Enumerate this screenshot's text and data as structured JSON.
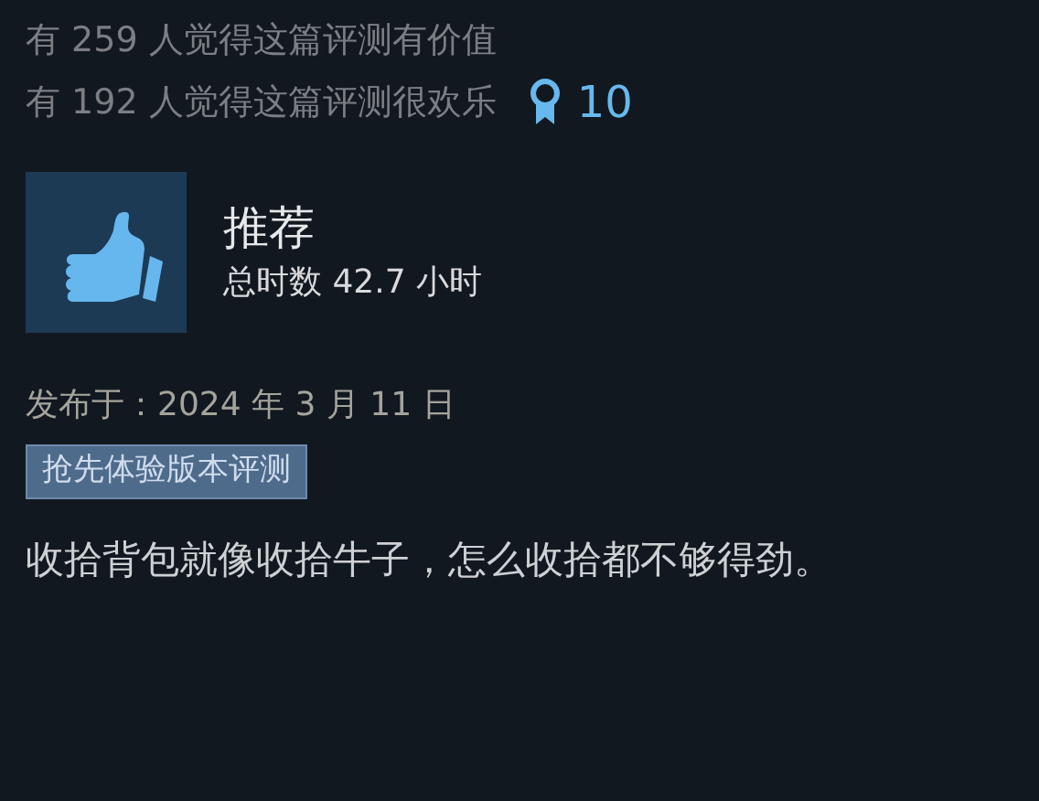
{
  "votes": [
    {
      "text": "有 259 人觉得这篇评测有价值"
    },
    {
      "text": "有 192 人觉得这篇评测很欢乐"
    }
  ],
  "award": {
    "count": "10"
  },
  "review": {
    "recommended": true,
    "verdict": "推荐",
    "playtime": "总时数 42.7 小时",
    "posted": "发布于：2024 年 3 月 11 日",
    "tag": "抢先体验版本评测",
    "body": "收拾背包就像收拾牛子，怎么收拾都不够得劲。"
  }
}
